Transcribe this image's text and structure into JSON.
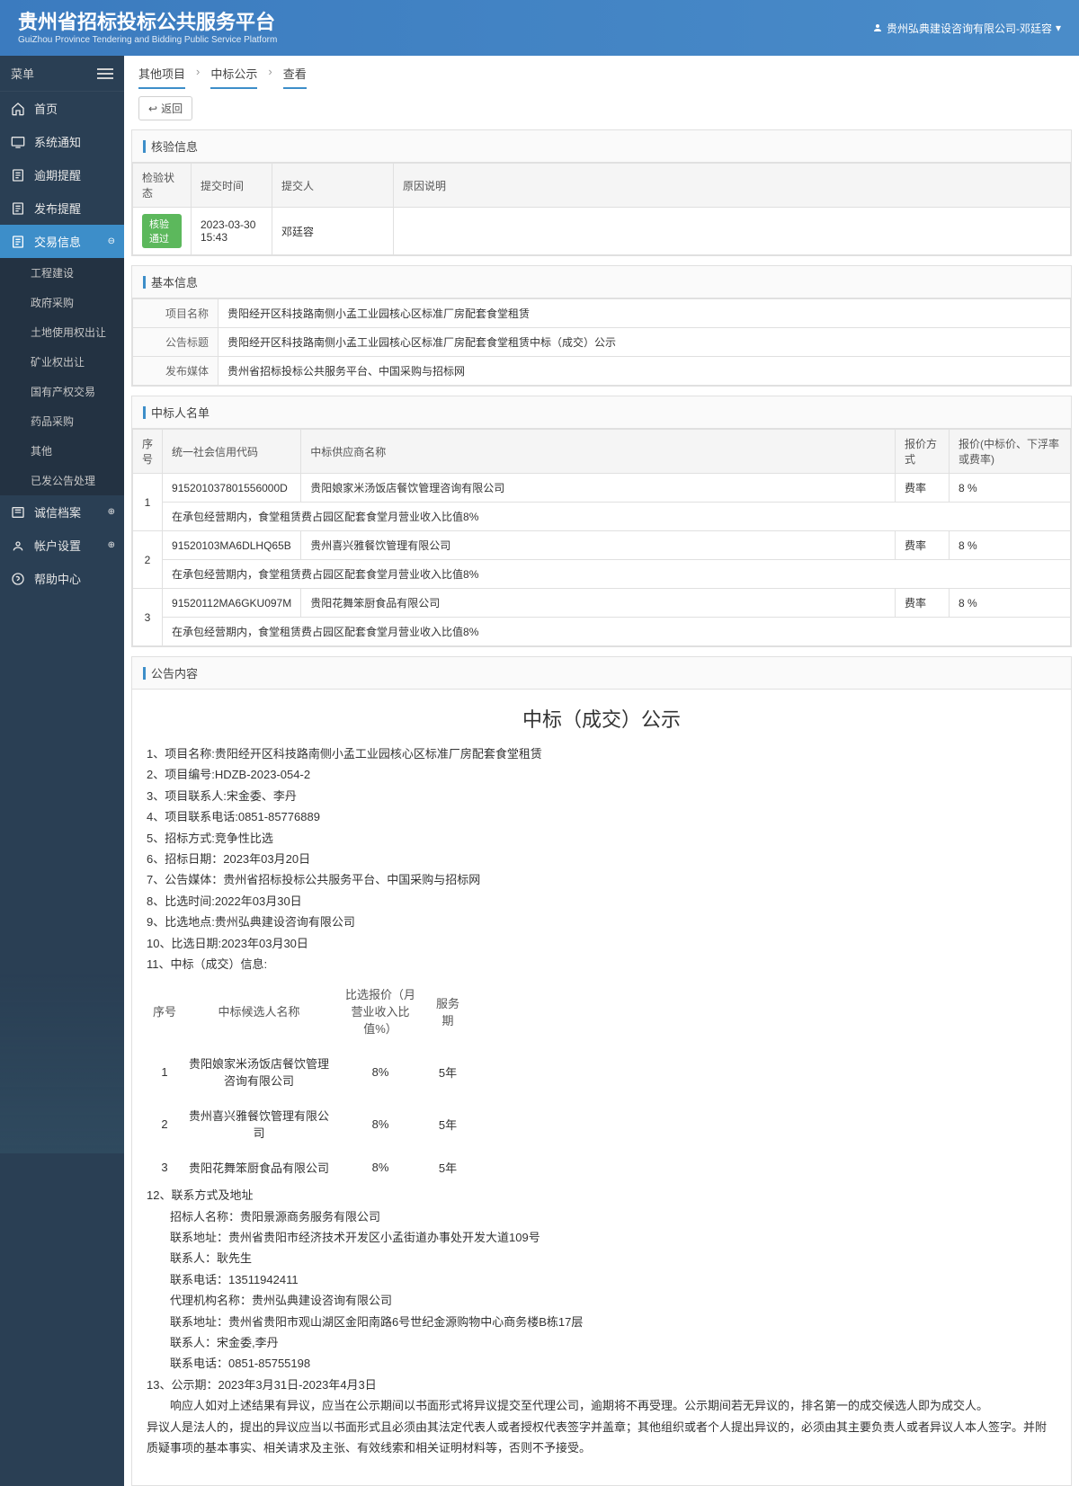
{
  "header": {
    "title": "贵州省招标投标公共服务平台",
    "subtitle": "GuiZhou Province Tendering and Bidding Public Service Platform",
    "user": "贵州弘典建设咨询有限公司-邓廷容"
  },
  "sidebar": {
    "menu_label": "菜单",
    "items": [
      {
        "label": "首页"
      },
      {
        "label": "系统通知"
      },
      {
        "label": "逾期提醒"
      },
      {
        "label": "发布提醒"
      },
      {
        "label": "交易信息",
        "active": true,
        "expandable": true,
        "children": [
          {
            "label": "工程建设"
          },
          {
            "label": "政府采购"
          },
          {
            "label": "土地使用权出让"
          },
          {
            "label": "矿业权出让"
          },
          {
            "label": "国有产权交易"
          },
          {
            "label": "药品采购"
          },
          {
            "label": "其他"
          },
          {
            "label": "已发公告处理"
          }
        ]
      },
      {
        "label": "诚信档案",
        "expandable": true
      },
      {
        "label": "帐户设置",
        "expandable": true
      },
      {
        "label": "帮助中心"
      }
    ]
  },
  "breadcrumb": [
    "其他项目",
    "中标公示",
    "查看"
  ],
  "back_label": "返回",
  "panels": {
    "check": {
      "title": "核验信息",
      "headers": [
        "检验状态",
        "提交时间",
        "提交人",
        "原因说明"
      ],
      "row": {
        "status": "核验通过",
        "time": "2023-03-30 15:43",
        "submitter": "邓廷容",
        "reason": ""
      }
    },
    "basic": {
      "title": "基本信息",
      "rows": [
        {
          "k": "项目名称",
          "v": "贵阳经开区科技路南侧小孟工业园核心区标准厂房配套食堂租赁"
        },
        {
          "k": "公告标题",
          "v": "贵阳经开区科技路南侧小孟工业园核心区标准厂房配套食堂租赁中标（成交）公示"
        },
        {
          "k": "发布媒体",
          "v": "贵州省招标投标公共服务平台、中国采购与招标网"
        }
      ]
    },
    "winners": {
      "title": "中标人名单",
      "headers": [
        "序号",
        "统一社会信用代码",
        "中标供应商名称",
        "报价方式",
        "报价(中标价、下浮率或费率)"
      ],
      "rows": [
        {
          "no": "1",
          "code": "915201037801556000D",
          "name": "贵阳娘家米汤饭店餐饮管理咨询有限公司",
          "method": "费率",
          "price": "8 %",
          "note": "在承包经营期内，食堂租赁费占园区配套食堂月营业收入比值8%"
        },
        {
          "no": "2",
          "code": "91520103MA6DLHQ65B",
          "name": "贵州喜兴雅餐饮管理有限公司",
          "method": "费率",
          "price": "8 %",
          "note": "在承包经营期内，食堂租赁费占园区配套食堂月营业收入比值8%"
        },
        {
          "no": "3",
          "code": "91520112MA6GKU097M",
          "name": "贵阳花舞笨厨食品有限公司",
          "method": "费率",
          "price": "8 %",
          "note": "在承包经营期内，食堂租赁费占园区配套食堂月营业收入比值8%"
        }
      ]
    },
    "content": {
      "title": "公告内容",
      "ann_title": "中标（成交）公示",
      "lines_top": [
        "1、项目名称:贵阳经开区科技路南侧小孟工业园核心区标准厂房配套食堂租赁",
        "2、项目编号:HDZB-2023-054-2",
        "3、项目联系人:宋金委、李丹",
        "4、项目联系电话:0851-85776889",
        "5、招标方式:竞争性比选",
        "6、招标日期：2023年03月20日",
        "7、公告媒体：贵州省招标投标公共服务平台、中国采购与招标网",
        "8、比选时间:2022年03月30日",
        "9、比选地点:贵州弘典建设咨询有限公司",
        "10、比选日期:2023年03月30日",
        "11、中标（成交）信息:"
      ],
      "table": {
        "headers": [
          "序号",
          "中标候选人名称",
          "比选报价（月营业收入比值%）",
          "服务期"
        ],
        "rows": [
          {
            "no": "1",
            "name": "贵阳娘家米汤饭店餐饮管理咨询有限公司",
            "bid": "8%",
            "period": "5年"
          },
          {
            "no": "2",
            "name": "贵州喜兴雅餐饮管理有限公司",
            "bid": "8%",
            "period": "5年"
          },
          {
            "no": "3",
            "name": "贵阳花舞笨厨食品有限公司",
            "bid": "8%",
            "period": "5年"
          }
        ]
      },
      "lines_bottom": [
        "12、联系方式及地址",
        "　　招标人名称：贵阳景源商务服务有限公司",
        "　　联系地址：贵州省贵阳市经济技术开发区小孟街道办事处开发大道109号",
        "　　联系人：耿先生",
        "　　联系电话：13511942411",
        "　　代理机构名称：贵州弘典建设咨询有限公司",
        "　　联系地址：贵州省贵阳市观山湖区金阳南路6号世纪金源购物中心商务楼B栋17层",
        "　　联系人：宋金委,李丹",
        "　　联系电话：0851-85755198",
        "13、公示期：2023年3月31日-2023年4月3日",
        "　　响应人如对上述结果有异议，应当在公示期间以书面形式将异议提交至代理公司，逾期将不再受理。公示期间若无异议的，排名第一的成交候选人即为成交人。"
      ],
      "footer": "异议人是法人的，提出的异议应当以书面形式且必须由其法定代表人或者授权代表签字并盖章；其他组织或者个人提出异议的，必须由其主要负责人或者异议人本人签字。并附质疑事项的基本事实、相关请求及主张、有效线索和相关证明材料等，否则不予接受。"
    }
  }
}
